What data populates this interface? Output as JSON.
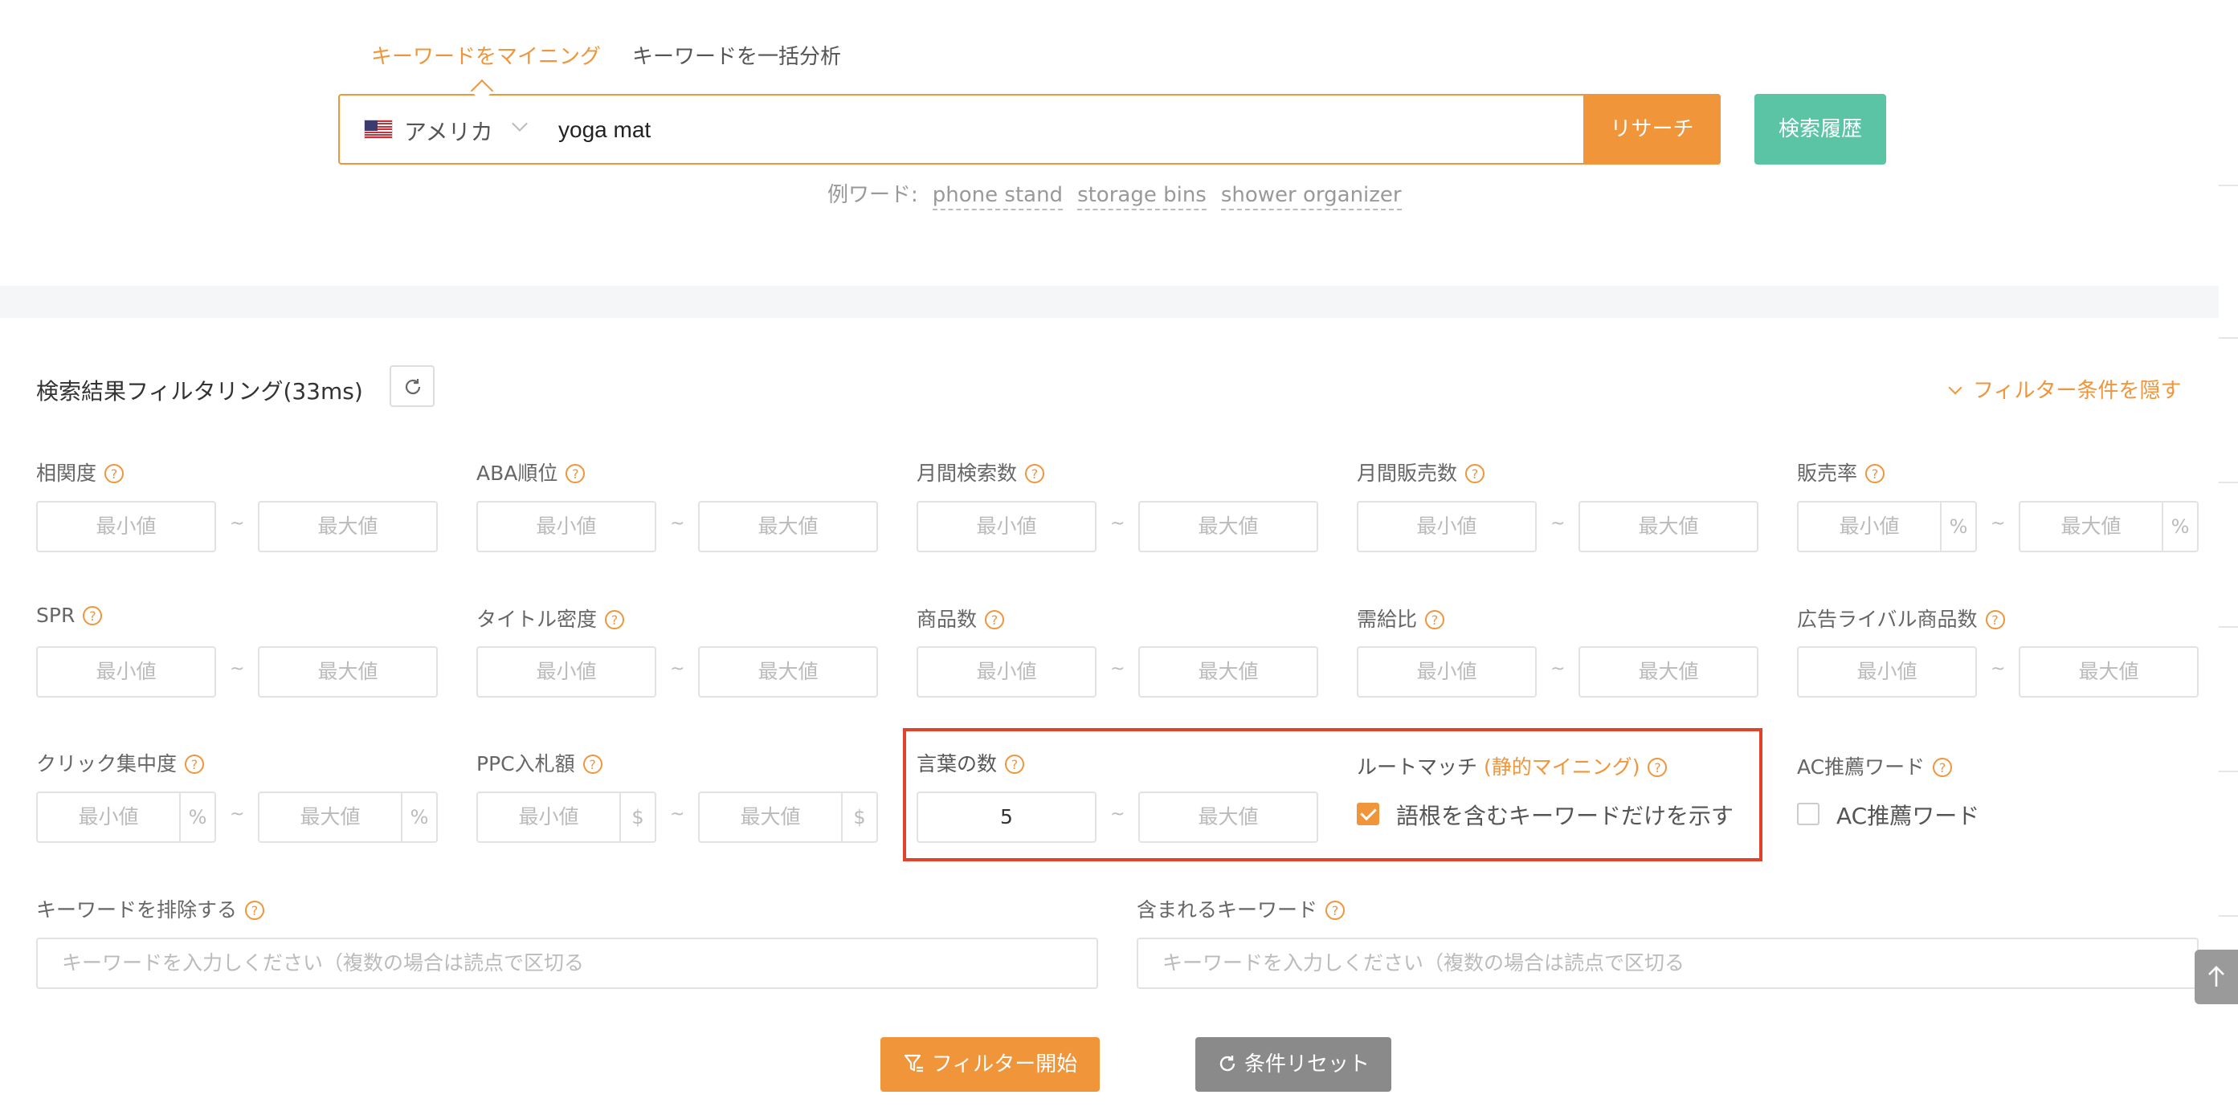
{
  "tabs": {
    "mining": "キーワードをマイニング",
    "bulk": "キーワードを一括分析"
  },
  "search": {
    "country": "アメリカ",
    "value": "yoga mat",
    "research_label": "リサーチ",
    "history_label": "検索履歴"
  },
  "examples": {
    "label": "例ワード:",
    "items": [
      "phone stand",
      "storage bins",
      "shower organizer"
    ]
  },
  "filter": {
    "title": "検索結果フィルタリング(33ms)",
    "hide_label": "フィルター条件を隠す",
    "min_placeholder": "最小値",
    "max_placeholder": "最大値",
    "tilde": "~",
    "fields": {
      "relevance": "相関度",
      "aba_rank": "ABA順位",
      "monthly_search": "月間検索数",
      "monthly_sales": "月間販売数",
      "sales_rate": "販売率",
      "spr": "SPR",
      "title_density": "タイトル密度",
      "product_count": "商品数",
      "supply_demand": "需給比",
      "ad_rivals": "広告ライバル商品数",
      "click_concentration": "クリック集中度",
      "ppc_bid": "PPC入札額",
      "word_count": "言葉の数",
      "root_match": "ルートマッチ",
      "root_match_tag": "(静的マイニング)",
      "ac_recommend": "AC推薦ワード",
      "exclude_keywords": "キーワードを排除する",
      "include_keywords": "含まれるキーワード"
    },
    "word_count_min_value": "5",
    "percent": "%",
    "dollar": "$",
    "root_match_checkbox": "語根を含むキーワードだけを示す",
    "root_match_checked": true,
    "ac_checkbox": "AC推薦ワード",
    "ac_checked": false,
    "keyword_placeholder": "キーワードを入力しください（複数の場合は読点で区切る",
    "start_label": "フィルター開始",
    "reset_label": "条件リセット"
  },
  "colors": {
    "accent": "#f0953a",
    "history": "#5bc4a4",
    "highlight": "#e0432a",
    "reset": "#8a8a8a"
  }
}
